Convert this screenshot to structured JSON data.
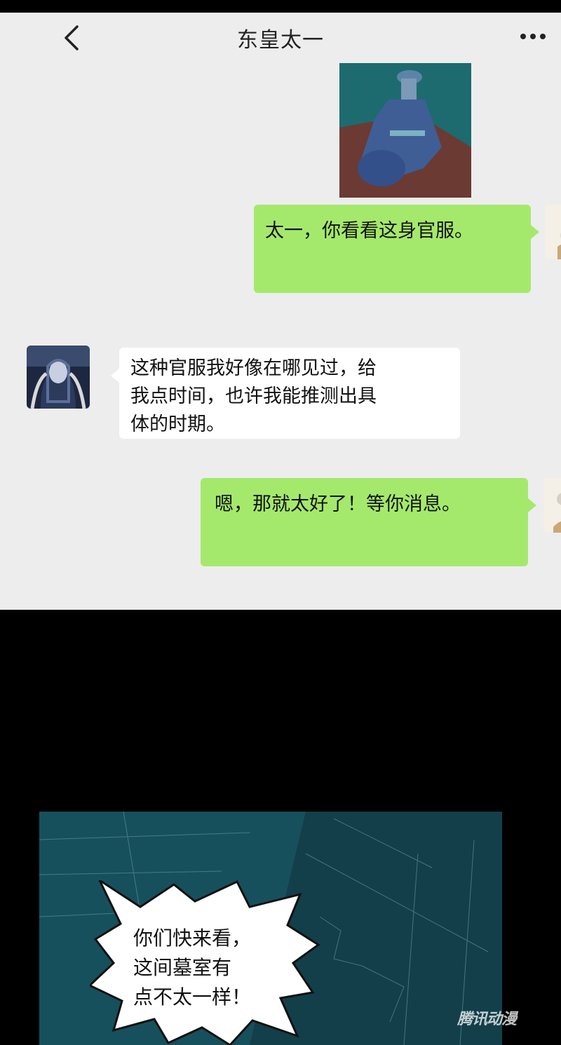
{
  "header": {
    "title": "东皇太一",
    "back_icon": "chevron-left-icon",
    "more_icon": "more-horizontal-icon"
  },
  "messages": [
    {
      "side": "right",
      "type": "image"
    },
    {
      "side": "right",
      "text": "太一，你看看这身官服。"
    },
    {
      "side": "left",
      "lines": [
        "这种官服我好像在哪见过，给",
        "我点时间，也许我能推测出具",
        "体的时期。"
      ]
    },
    {
      "side": "right",
      "text": "嗯，那就太好了！等你消息。"
    }
  ],
  "speech": {
    "lines": [
      "你们快来看，",
      "这间墓室有",
      "点不太一样！"
    ]
  },
  "watermark": "腾讯动漫",
  "colors": {
    "chat_bg": "#ededed",
    "bubble_green": "#a5e96c",
    "bubble_white": "#ffffff",
    "panel_teal": "#17505d"
  }
}
